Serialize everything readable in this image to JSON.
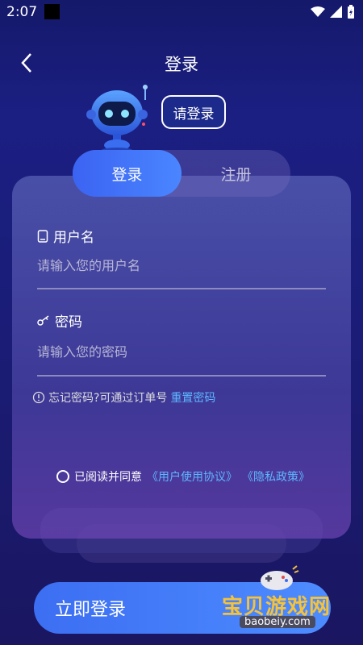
{
  "status": {
    "time": "2:07"
  },
  "header": {
    "title": "登录"
  },
  "robot": {
    "bubble": "请登录"
  },
  "tabs": {
    "login": "登录",
    "register": "注册"
  },
  "form": {
    "username_label": "用户名",
    "username_placeholder": "请输入您的用户名",
    "password_label": "密码",
    "password_placeholder": "请输入您的密码",
    "forgot_text": "忘记密码?可通过订单号",
    "reset_link": "重置密码",
    "agree_text": "已阅读并同意",
    "terms_link": "《用户使用协议》",
    "privacy_link": "《隐私政策》",
    "submit_label": "立即登录"
  },
  "watermark": {
    "text": "宝贝游戏网",
    "url": "baobeiy.com"
  },
  "colors": {
    "accent": "#4a86ff",
    "link": "#5eb6ff"
  }
}
